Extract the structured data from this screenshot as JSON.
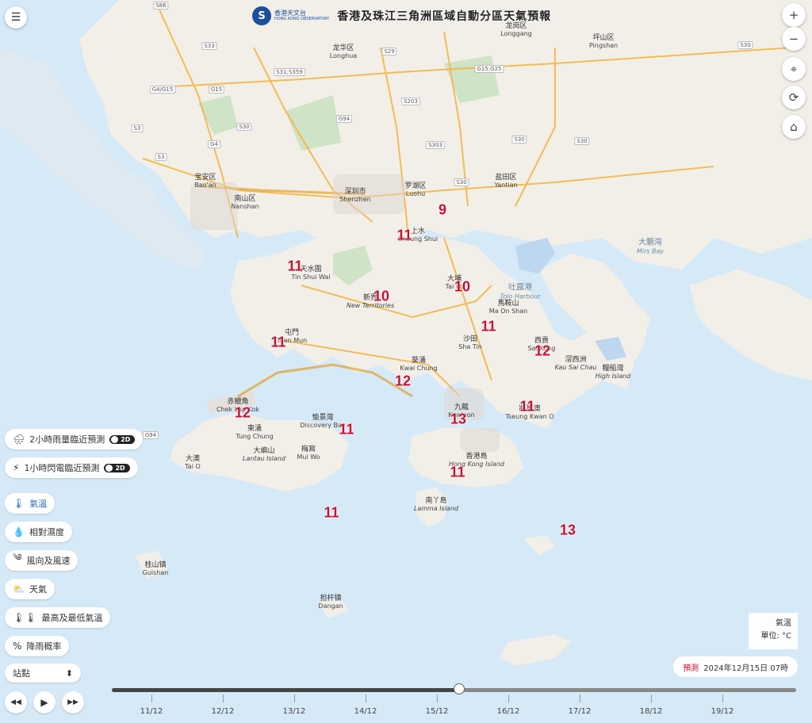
{
  "header": {
    "logo_zh": "香港天文台",
    "logo_en": "HONG KONG OBSERVATORY",
    "title": "香港及珠江三角洲區域自動分區天氣預報"
  },
  "map_controls": {
    "zoom_in": "+",
    "zoom_out": "−",
    "locate_icon": "⌖",
    "refresh_icon": "⟳",
    "home_icon": "⌂",
    "menu_icon": "☰"
  },
  "temperatures": [
    "9",
    "11",
    "11",
    "10",
    "10",
    "11",
    "11",
    "12",
    "12",
    "12",
    "11",
    "13",
    "11",
    "11",
    "11",
    "13"
  ],
  "places": [
    {
      "zh": "龙岗区",
      "en": "Longgang"
    },
    {
      "zh": "坪山区",
      "en": "Pingshan"
    },
    {
      "zh": "龙华区",
      "en": "Longhua"
    },
    {
      "zh": "宝安区",
      "en": "Bao'an"
    },
    {
      "zh": "南山区",
      "en": "Nanshan"
    },
    {
      "zh": "深圳市",
      "en": "Shenzhen"
    },
    {
      "zh": "罗湖区",
      "en": "Luohu"
    },
    {
      "zh": "盐田区",
      "en": "Yantian"
    },
    {
      "zh": "大鵬灣",
      "en": "Mirs Bay"
    },
    {
      "zh": "上水",
      "en": "Sheung Shui"
    },
    {
      "zh": "天水圍",
      "en": "Tin Shui Wai"
    },
    {
      "zh": "新界",
      "en": "New Territories"
    },
    {
      "zh": "大埔",
      "en": "Tai Po"
    },
    {
      "zh": "吐露港",
      "en": "Tolo Harbour"
    },
    {
      "zh": "馬鞍山",
      "en": "Ma On Shan"
    },
    {
      "zh": "屯門",
      "en": "Tuen Mun"
    },
    {
      "zh": "沙田",
      "en": "Sha Tin"
    },
    {
      "zh": "西貢",
      "en": "Sai Kung"
    },
    {
      "zh": "滘西洲",
      "en": "Kau Sai Chau"
    },
    {
      "zh": "糧船灣",
      "en": "High Island"
    },
    {
      "zh": "葵涌",
      "en": "Kwai Chung"
    },
    {
      "zh": "赤鱲角",
      "en": "Chek Lap Kok"
    },
    {
      "zh": "愉景灣",
      "en": "Discovery Bay"
    },
    {
      "zh": "九龍",
      "en": "Kowloon"
    },
    {
      "zh": "將軍澳",
      "en": "Tseung Kwan O"
    },
    {
      "zh": "東涌",
      "en": "Tung Chung"
    },
    {
      "zh": "大嶼山",
      "en": "Lantau Island"
    },
    {
      "zh": "梅窩",
      "en": "Mui Wo"
    },
    {
      "zh": "香港島",
      "en": "Hong Kong Island"
    },
    {
      "zh": "大澳",
      "en": "Tai O"
    },
    {
      "zh": "南丫島",
      "en": "Lamma Island"
    },
    {
      "zh": "桂山镇",
      "en": "Guishan"
    },
    {
      "zh": "担杆镇",
      "en": "Dangan"
    }
  ],
  "road_labels": [
    "S86",
    "S33",
    "G4/G15",
    "G15",
    "S3",
    "S3",
    "S29",
    "S31;S359",
    "G94",
    "S303",
    "G15;G25",
    "S30",
    "S30",
    "S203",
    "G4",
    "S30",
    "S30",
    "G94",
    "S30"
  ],
  "layers": [
    {
      "icon": "🌧",
      "label": "2小時雨量臨近預測",
      "toggle": "2D"
    },
    {
      "icon": "⚡",
      "label": "1小時閃電臨近預測",
      "toggle": "2D"
    },
    {
      "icon": "🌡",
      "label": "氣溫",
      "active": true
    },
    {
      "icon": "💧",
      "label": "相對濕度"
    },
    {
      "icon": "༄",
      "label": "風向及風速"
    },
    {
      "icon": "⛅",
      "label": "天氣"
    },
    {
      "icon": "🌡🌡",
      "label": "最高及最低氣溫"
    },
    {
      "icon": "%",
      "label": "降雨概率"
    }
  ],
  "station_select": {
    "value": "站點",
    "arrow": "⬍"
  },
  "playback": {
    "rewind": "◀◀",
    "play": "▶",
    "forward": "▶▶"
  },
  "legend": {
    "line1": "氣溫",
    "line2": "單位: °C"
  },
  "forecast": {
    "label": "預測",
    "time": "2024年12月15日 07時"
  },
  "timeline": {
    "dates": [
      "11/12",
      "12/12",
      "13/12",
      "14/12",
      "15/12",
      "16/12",
      "17/12",
      "18/12",
      "19/12"
    ],
    "position_fraction": 0.508
  },
  "colors": {
    "temp": "#c8102e",
    "sea": "#d6e9f7",
    "land": "#f2efe9",
    "accent": "#2a6dbf"
  }
}
